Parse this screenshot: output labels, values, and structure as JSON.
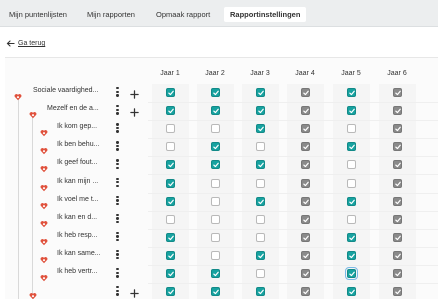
{
  "tabs": [
    {
      "label": "Mijn puntenlijsten",
      "active": false
    },
    {
      "label": "Mijn rapporten",
      "active": false
    },
    {
      "label": "Opmaak rapport",
      "active": false
    },
    {
      "label": "Rapportinstellingen",
      "active": true
    }
  ],
  "back_label": "Ga terug",
  "columns": [
    "Jaar 1",
    "Jaar 2",
    "Jaar 3",
    "Jaar 4",
    "Jaar 5",
    "Jaar 6"
  ],
  "colors": {
    "accent": "#17a2a0",
    "inherited": "#8a8a8a",
    "heart": "#e0513c"
  },
  "rows": [
    {
      "label": "Sociale vaardighed...",
      "level": 0,
      "has_plus": true,
      "checks": [
        "teal",
        "teal",
        "teal",
        "grey",
        "teal",
        "grey"
      ]
    },
    {
      "label": "Mezelf en de a...",
      "level": 1,
      "has_plus": true,
      "checks": [
        "teal",
        "teal",
        "teal",
        "grey",
        "teal",
        "grey"
      ]
    },
    {
      "label": "Ik kom gep...",
      "level": 2,
      "has_plus": false,
      "checks": [
        "off",
        "off",
        "teal",
        "grey",
        "off",
        "grey"
      ]
    },
    {
      "label": "Ik ben behu...",
      "level": 2,
      "has_plus": false,
      "checks": [
        "off",
        "teal",
        "off",
        "grey",
        "teal",
        "grey"
      ]
    },
    {
      "label": "Ik geef fout...",
      "level": 2,
      "has_plus": false,
      "checks": [
        "teal",
        "teal",
        "teal",
        "grey",
        "off",
        "grey"
      ]
    },
    {
      "label": "Ik kan mijn ...",
      "level": 2,
      "has_plus": false,
      "checks": [
        "teal",
        "off",
        "off",
        "grey",
        "off",
        "grey"
      ]
    },
    {
      "label": "Ik voel me t...",
      "level": 2,
      "has_plus": false,
      "checks": [
        "teal",
        "off",
        "teal",
        "grey",
        "teal",
        "grey"
      ]
    },
    {
      "label": "Ik kan en d...",
      "level": 2,
      "has_plus": false,
      "checks": [
        "off",
        "off",
        "off",
        "grey",
        "off",
        "grey"
      ]
    },
    {
      "label": "Ik heb resp...",
      "level": 2,
      "has_plus": false,
      "checks": [
        "teal",
        "off",
        "off",
        "grey",
        "teal",
        "grey"
      ]
    },
    {
      "label": "Ik kan same...",
      "level": 2,
      "has_plus": false,
      "checks": [
        "teal",
        "off",
        "teal",
        "grey",
        "teal",
        "grey"
      ]
    },
    {
      "label": "Ik heb vertr...",
      "level": 2,
      "has_plus": false,
      "checks": [
        "teal",
        "teal",
        "off",
        "grey",
        "teal-focus",
        "grey"
      ]
    },
    {
      "label": "",
      "level": 1,
      "has_plus": true,
      "checks": [
        "teal",
        "teal",
        "teal",
        "grey",
        "teal",
        "grey"
      ]
    }
  ]
}
